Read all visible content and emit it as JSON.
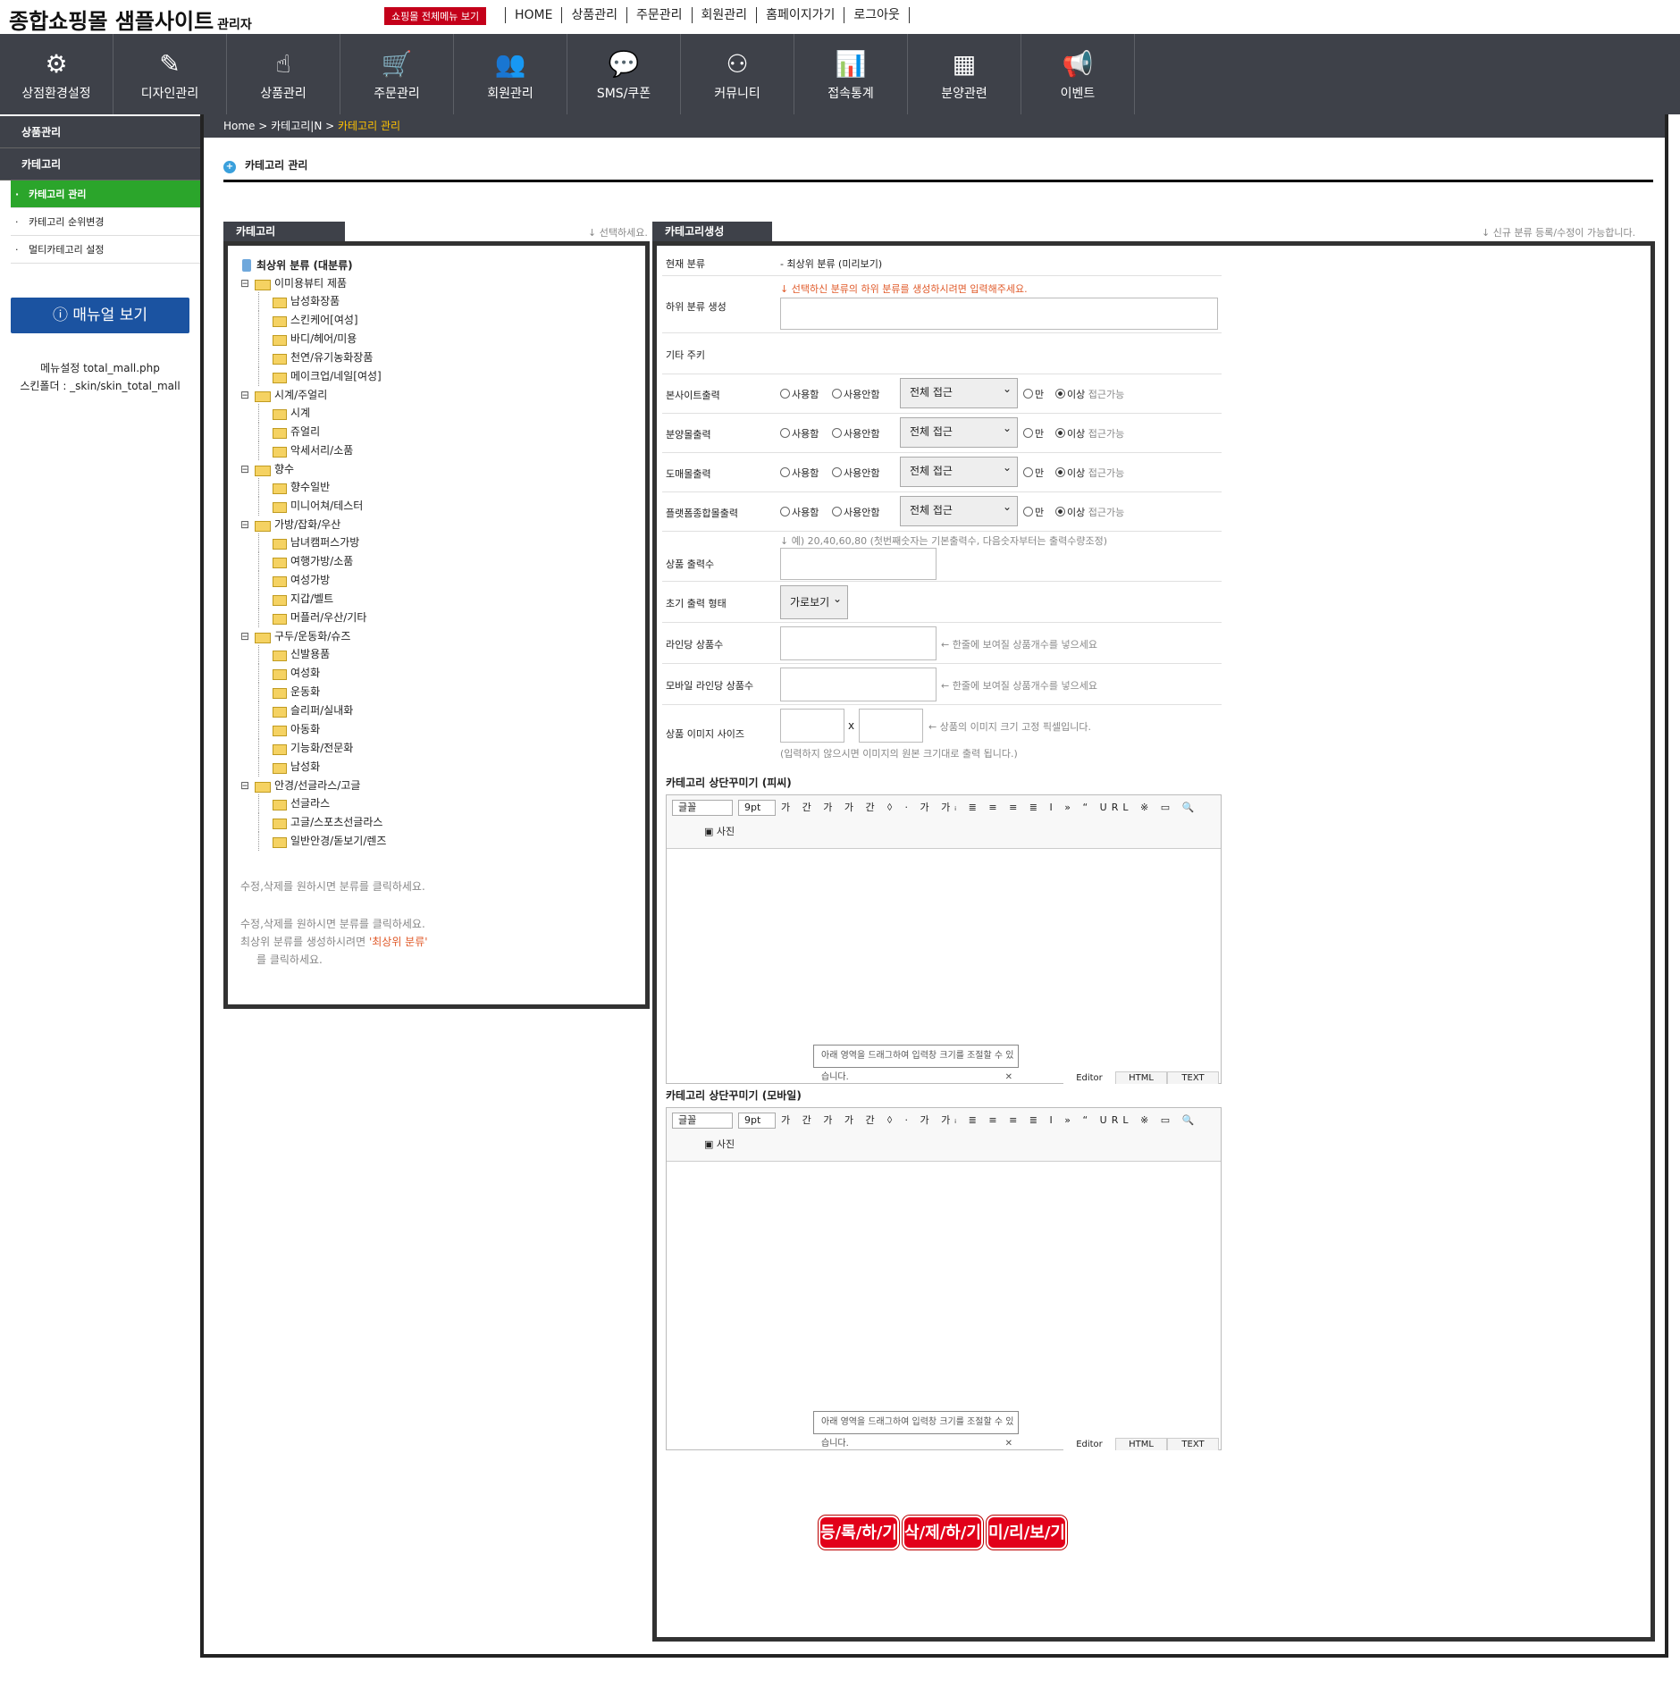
{
  "header": {
    "site_title": "종합쇼핑몰 샘플사이트",
    "site_sub": "관리자",
    "all_menu": "쇼핑몰 전체메뉴 보기",
    "links": [
      "HOME",
      "상품관리",
      "주문관리",
      "회원관리",
      "홈페이지가기",
      "로그아웃"
    ]
  },
  "gnb": [
    {
      "label": "상점환경설정",
      "icon": "⚙",
      "icon_name": "gear-icon"
    },
    {
      "label": "디자인관리",
      "icon": "✎",
      "icon_name": "pencil-icon"
    },
    {
      "label": "상품관리",
      "icon": "☝",
      "icon_name": "hand-icon"
    },
    {
      "label": "주문관리",
      "icon": "🛒",
      "icon_name": "cart-icon"
    },
    {
      "label": "회원관리",
      "icon": "👥",
      "icon_name": "users-icon"
    },
    {
      "label": "SMS/쿠폰",
      "icon": "💬",
      "icon_name": "chat-icon"
    },
    {
      "label": "커뮤니티",
      "icon": "⚇",
      "icon_name": "community-icon"
    },
    {
      "label": "접속통계",
      "icon": "📊",
      "icon_name": "chart-icon"
    },
    {
      "label": "분양관련",
      "icon": "▦",
      "icon_name": "table-icon"
    },
    {
      "label": "이벤트",
      "icon": "📢",
      "icon_name": "megaphone-icon"
    }
  ],
  "sidebar": {
    "section": "상품관리",
    "group": "카테고리",
    "items": [
      "카테고리 관리",
      "카테고리 순위변경",
      "멀티카테고리 설정"
    ],
    "manual": "매뉴얼 보기",
    "info1": "메뉴설정 total_mall.php",
    "info2": "스킨폴더 : _skin/skin_total_mall"
  },
  "breadcrumb": {
    "path": "Home > 카테고리|N > ",
    "current": "카테고리 관리"
  },
  "page_title": "카테고리 관리",
  "category": {
    "tab": "카테고리",
    "hint": "↓ 선택하세요.",
    "root": "최상위 분류 (대분류)",
    "tree": [
      {
        "name": "이미용뷰티 제품",
        "children": [
          "남성화장품",
          "스킨케어[여성]",
          "바디/헤어/미용",
          "천연/유기농화장품",
          "메이크업/네일[여성]"
        ]
      },
      {
        "name": "시계/주얼리",
        "children": [
          "시계",
          "쥬얼리",
          "악세서리/소품"
        ]
      },
      {
        "name": "향수",
        "children": [
          "향수일반",
          "미니어쳐/테스터"
        ]
      },
      {
        "name": "가방/잡화/우산",
        "children": [
          "남녀캠퍼스가방",
          "여행가방/소품",
          "여성가방",
          "지갑/벨트",
          "머플러/우산/기타"
        ]
      },
      {
        "name": "구두/운동화/슈즈",
        "children": [
          "신발용품",
          "여성화",
          "운동화",
          "슬리퍼/실내화",
          "아동화",
          "기능화/전문화",
          "남성화"
        ]
      },
      {
        "name": "안경/선글라스/고글",
        "children": [
          "선글라스",
          "고글/스포츠선글라스",
          "일반안경/돋보기/렌즈"
        ]
      }
    ],
    "note1": "수정,삭제를 원하시면 분류를 클릭하세요.",
    "note2": "수정,삭제를 원하시면 분류를 클릭하세요.",
    "note3a": "최상위 분류를 생성하시려면 ",
    "note3b": "'최상위 분류'",
    "note4": "를 클릭하세요."
  },
  "form": {
    "tab": "카테고리생성",
    "hint": "↓ 신규 분류 등록/수정이 가능합니다.",
    "current_label": "현재 분류",
    "current_value": "- 최상위 분류 (미리보기)",
    "sub_label": "하위 분류 생성",
    "sub_hint": "↓ 선택하신 분류의 하위 분류를 생성하시려면 입력해주세요.",
    "memo_label": "기타 주키",
    "outputs": [
      {
        "label": "본사이트출력",
        "use": "사용함",
        "nouse": "사용안함",
        "access": "전체 접근",
        "only": "만",
        "above": "이상",
        "access_hint": "접근가능"
      },
      {
        "label": "분양몰출력",
        "use": "사용함",
        "nouse": "사용안함",
        "access": "전체 접근",
        "only": "만",
        "above": "이상",
        "access_hint": "접근가능"
      },
      {
        "label": "도매몰출력",
        "use": "사용함",
        "nouse": "사용안함",
        "access": "전체 접근",
        "only": "만",
        "above": "이상",
        "access_hint": "접근가능"
      },
      {
        "label": "플랫폼종합몰출력",
        "use": "사용함",
        "nouse": "사용안함",
        "access": "전체 접근",
        "only": "만",
        "above": "이상",
        "access_hint": "접근가능"
      }
    ],
    "count_label": "상품 출력수",
    "count_hint": "↓ 예) 20,40,60,80 (첫번째숫자는 기본출력수, 다음숫자부터는 출력수량조정)",
    "view_label": "초기 출력 형태",
    "view_value": "가로보기",
    "line_label": "라인당 상품수",
    "line_hint": "← 한줄에 보여질 상품개수를 넣으세요",
    "mline_label": "모바일 라인당 상품수",
    "mline_hint": "← 한줄에 보여질 상품개수를 넣으세요",
    "img_label": "상품 이미지 사이즈",
    "img_x": "x",
    "img_hint": "← 상품의 이미지 크기 고정 픽셀입니다.",
    "img_hint2": "(입력하지 않으시면 이미지의 원본 크기대로 출력 됩니다.)",
    "editor_pc": "카테고리 상단꾸미기 (피씨)",
    "editor_mobile": "카테고리 상단꾸미기 (모바일)",
    "font_sel": "글꼴",
    "size_sel": "9pt",
    "toolbar": "가 간 가 가 간 ꕺ · 가 가ᵢ ≣ ≡ ≡ ≣ I » “ URL ※ ▭ 🔍",
    "photo": "사진",
    "tip": "아래 영역을 드래그하여 입력창 크기를 조절할 수 있습니다.",
    "mode_tabs": [
      "Editor",
      "HTML",
      "TEXT"
    ],
    "btn_register": "등/록/하/기",
    "btn_delete": "삭/제/하/기",
    "btn_preview": "미/리/보/기"
  }
}
